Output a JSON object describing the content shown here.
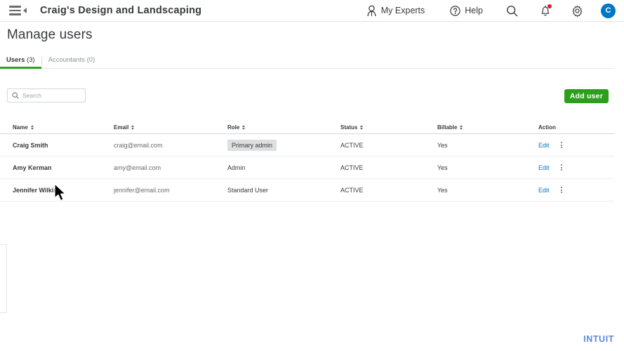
{
  "header": {
    "menu_icon": "hamburger-collapse-icon",
    "company": "Craig's Design and Landscaping",
    "my_experts_label": "My Experts",
    "my_experts_icon": "person-icon",
    "help_label": "Help",
    "help_icon": "question-circle-icon",
    "search_icon": "search-icon",
    "notifications_icon": "bell-icon",
    "settings_icon": "gear-icon",
    "avatar_initial": "C",
    "avatar_color": "#0077c5",
    "notification_dot_color": "#e01e1e"
  },
  "page": {
    "title": "Manage users"
  },
  "tabs": [
    {
      "label": "Users",
      "count": "(3)",
      "active": true
    },
    {
      "label": "Accountants",
      "count": "(0)",
      "active": false
    }
  ],
  "toolbar": {
    "search_placeholder": "Search",
    "search_value": "",
    "add_user_label": "Add user",
    "add_user_color": "#2ca01c"
  },
  "table": {
    "columns": [
      {
        "label": "Name",
        "sortable": true
      },
      {
        "label": "Email",
        "sortable": true
      },
      {
        "label": "Role",
        "sortable": true
      },
      {
        "label": "Status",
        "sortable": true
      },
      {
        "label": "Billable",
        "sortable": true
      },
      {
        "label": "Action",
        "sortable": false
      }
    ],
    "rows": [
      {
        "name": "Craig Smith",
        "email": "craig@email.com",
        "role": "Primary admin",
        "role_badge": true,
        "status": "ACTIVE",
        "billable": "Yes",
        "edit_label": "Edit"
      },
      {
        "name": "Amy Kerman",
        "email": "amy@email.com",
        "role": "Admin",
        "role_badge": false,
        "status": "ACTIVE",
        "billable": "Yes",
        "edit_label": "Edit"
      },
      {
        "name": "Jennifer Wilkins",
        "email": "jennifer@email.com",
        "role": "Standard User",
        "role_badge": false,
        "status": "ACTIVE",
        "billable": "Yes",
        "edit_label": "Edit"
      }
    ]
  },
  "footer": {
    "brand": "INTUIT",
    "brand_color": "#5b8ad9"
  }
}
